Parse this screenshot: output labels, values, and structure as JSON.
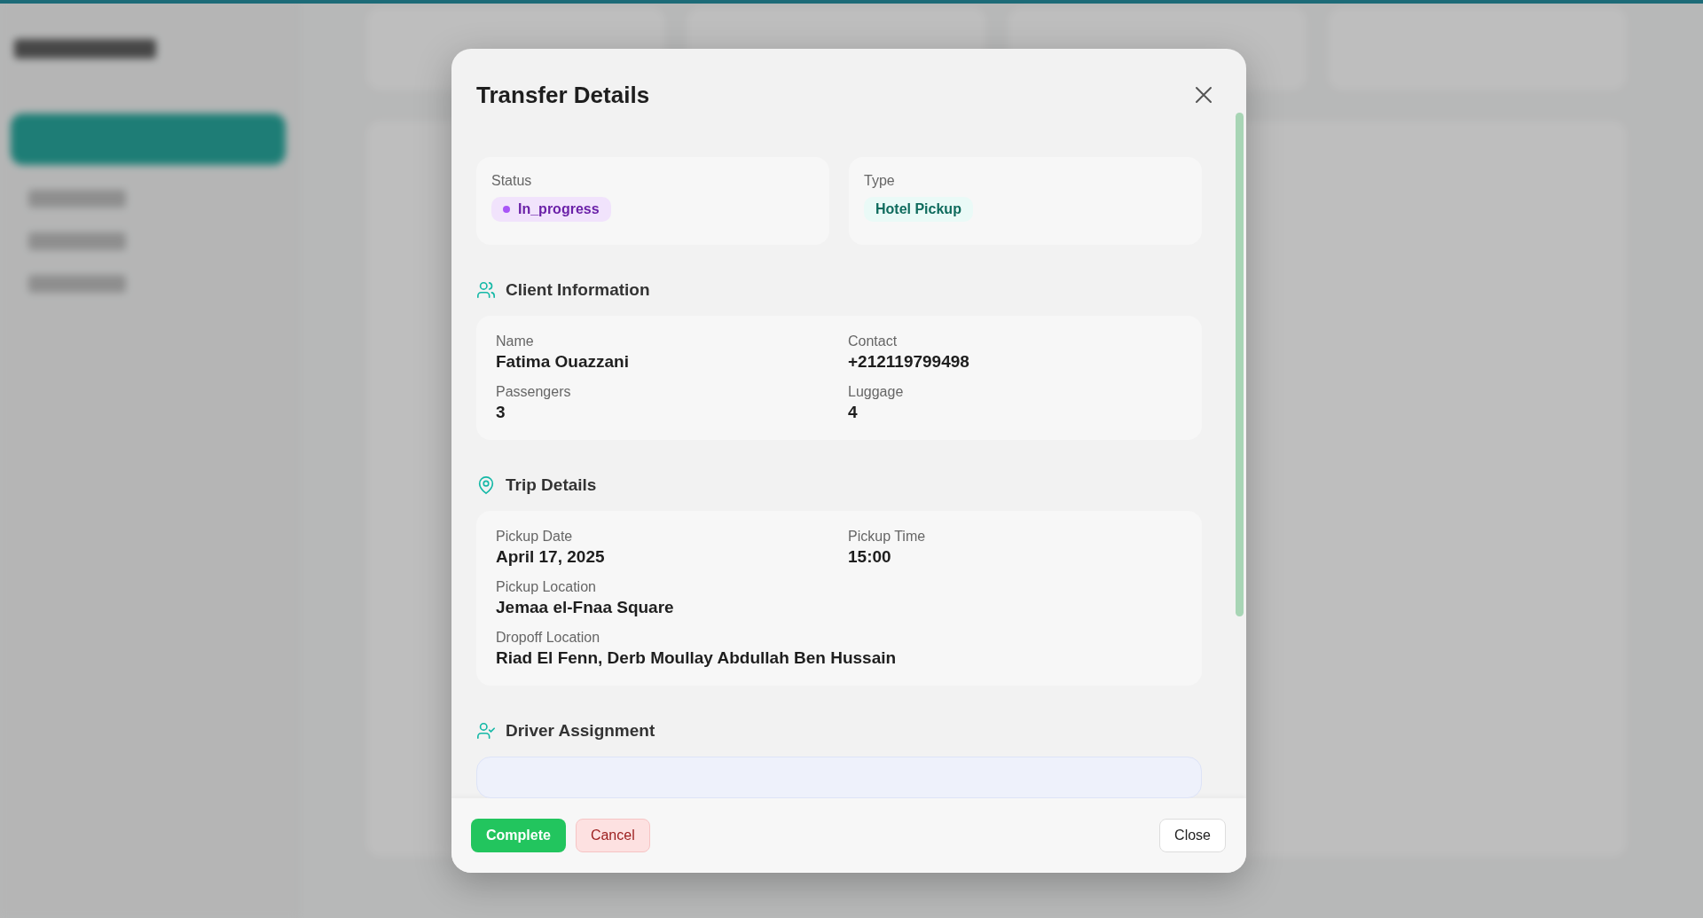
{
  "modal": {
    "title": "Transfer Details",
    "summary": [
      {
        "kind": "status",
        "label": "Status",
        "value": "In_progress"
      },
      {
        "kind": "type",
        "label": "Type",
        "value": "Hotel Pickup"
      }
    ],
    "sections": [
      {
        "kind": "client",
        "title": "Client Information",
        "rows": [
          [
            {
              "label": "Name",
              "value": "Fatima Ouazzani"
            },
            {
              "label": "Contact",
              "value": "+212119799498"
            }
          ],
          [
            {
              "label": "Passengers",
              "value": "3"
            },
            {
              "label": "Luggage",
              "value": "4"
            }
          ]
        ]
      },
      {
        "kind": "trip",
        "title": "Trip Details",
        "rows": [
          [
            {
              "label": "Pickup Date",
              "value": "April 17, 2025"
            },
            {
              "label": "Pickup Time",
              "value": "15:00"
            }
          ],
          [
            {
              "label": "Pickup Location",
              "value": "Jemaa el-Fnaa Square"
            }
          ],
          [
            {
              "label": "Dropoff Location",
              "value": "Riad El Fenn, Derb Moullay Abdullah Ben Hussain"
            }
          ]
        ]
      },
      {
        "kind": "driver",
        "title": "Driver Assignment"
      }
    ],
    "buttons": [
      {
        "kind": "complete",
        "label": "Complete"
      },
      {
        "kind": "cancel",
        "label": "Cancel"
      },
      {
        "kind": "close",
        "label": "Close"
      }
    ]
  }
}
